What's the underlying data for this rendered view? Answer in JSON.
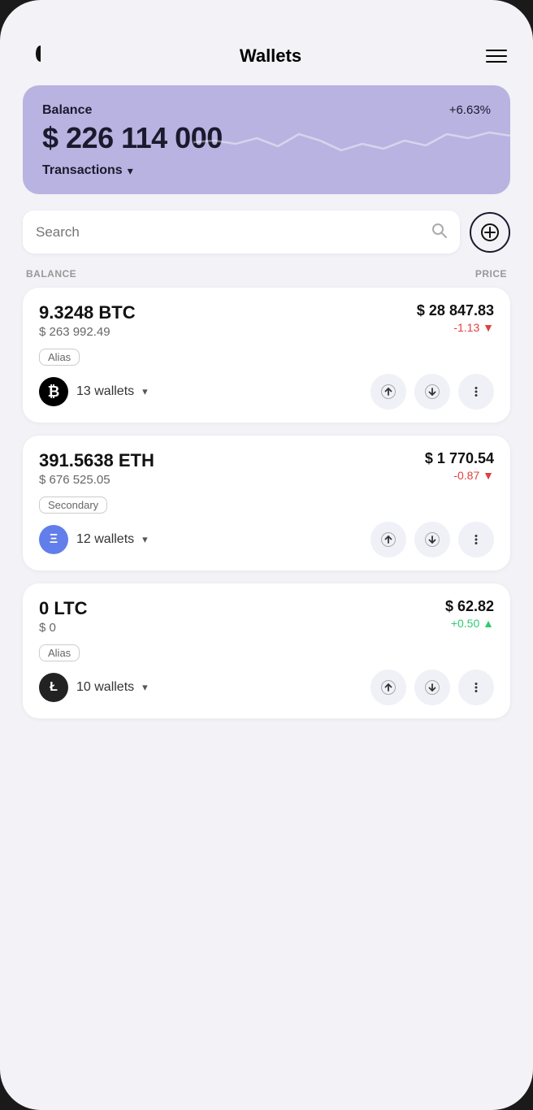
{
  "app": {
    "title": "Wallets"
  },
  "header": {
    "title": "Wallets",
    "menu_label": "menu"
  },
  "balance_card": {
    "label": "Balance",
    "amount": "$ 226 114 000",
    "percent_change": "+6.63%",
    "transactions_label": "Transactions"
  },
  "search": {
    "placeholder": "Search",
    "add_label": "+"
  },
  "columns": {
    "balance_label": "BALANCE",
    "price_label": "PRICE"
  },
  "assets": [
    {
      "id": "btc",
      "amount": "9.3248 BTC",
      "usd_value": "$ 263 992.49",
      "price": "$ 28 847.83",
      "change": "-1.13",
      "change_type": "negative",
      "tag": "Alias",
      "wallet_count": "13 wallets",
      "symbol": "₿"
    },
    {
      "id": "eth",
      "amount": "391.5638 ETH",
      "usd_value": "$ 676 525.05",
      "price": "$ 1 770.54",
      "change": "-0.87",
      "change_type": "negative",
      "tag": "Secondary",
      "wallet_count": "12 wallets",
      "symbol": "Ξ"
    },
    {
      "id": "ltc",
      "amount": "0 LTC",
      "usd_value": "$ 0",
      "price": "$ 62.82",
      "change": "+0.50",
      "change_type": "positive",
      "tag": "Alias",
      "wallet_count": "10 wallets",
      "symbol": "Ł"
    }
  ]
}
